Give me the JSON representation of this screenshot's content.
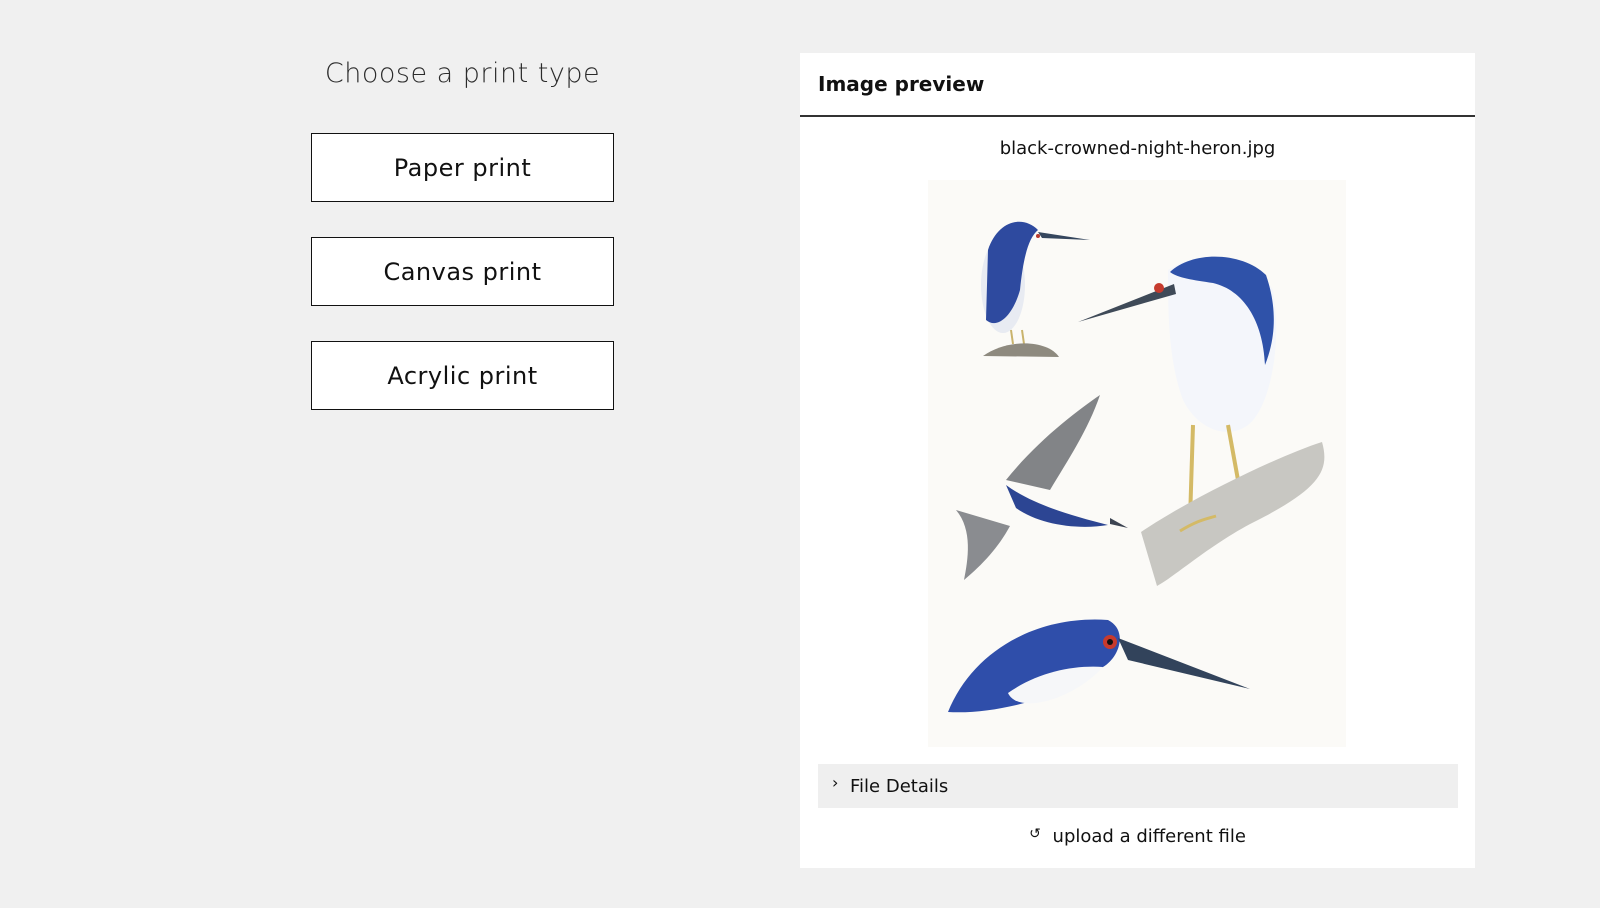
{
  "print_options": {
    "title": "Choose a print type",
    "buttons": [
      {
        "label": "Paper print"
      },
      {
        "label": "Canvas print"
      },
      {
        "label": "Acrylic print"
      }
    ]
  },
  "preview": {
    "header": "Image preview",
    "file_name": "black-crowned-night-heron.jpg",
    "file_details_label": "File Details",
    "file_details_icon": "chevron-right-icon",
    "upload_label": "upload a different file",
    "upload_icon": "refresh-icon"
  },
  "colors": {
    "page_background": "#f0f0f0",
    "panel_background": "#ffffff",
    "border": "#111111",
    "details_background": "#efefef",
    "heron_blue": "#2f4fa3"
  }
}
